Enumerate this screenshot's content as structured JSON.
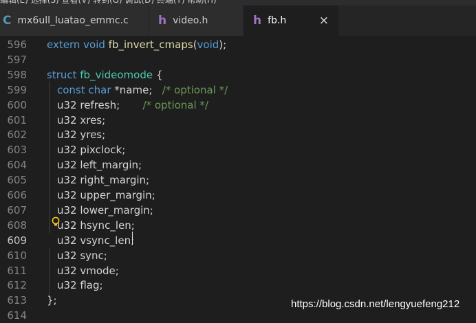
{
  "menubar": {
    "text": "编辑(E)  选择(S)  查看(V)  转到(G)  调试(D)  终端(T)  帮助(H)"
  },
  "tabs": [
    {
      "icon": "C",
      "icon_color": "#519aba",
      "label": "mx6ull_luatao_emmc.c",
      "active": false
    },
    {
      "icon": "h",
      "icon_color": "#a074c4",
      "label": "video.h",
      "active": false
    },
    {
      "icon": "h",
      "icon_color": "#a074c4",
      "label": "fb.h",
      "active": true,
      "close": "×"
    }
  ],
  "editor": {
    "current_line": "609",
    "lines": [
      {
        "n": "596",
        "tokens": [
          [
            "kw",
            "extern "
          ],
          [
            "kw",
            "void "
          ],
          [
            "fn",
            "fb_invert_cmaps"
          ],
          [
            "pu",
            "("
          ],
          [
            "kw",
            "void"
          ],
          [
            "pu",
            ");"
          ]
        ]
      },
      {
        "n": "597",
        "tokens": []
      },
      {
        "n": "598",
        "tokens": [
          [
            "kw",
            "struct "
          ],
          [
            "ty",
            "fb_videomode"
          ],
          [
            "pu",
            " {"
          ]
        ]
      },
      {
        "n": "599",
        "tokens": [
          [
            "kw",
            "const "
          ],
          [
            "kw",
            "char "
          ],
          [
            "pu",
            "*"
          ],
          [
            "id",
            "name"
          ],
          [
            "pu",
            ";   "
          ],
          [
            "cm",
            "/* optional */"
          ]
        ]
      },
      {
        "n": "600",
        "tokens": [
          [
            "id",
            "u32 refresh;"
          ],
          [
            "pu",
            "       "
          ],
          [
            "cm",
            "/* optional */"
          ]
        ]
      },
      {
        "n": "601",
        "tokens": [
          [
            "id",
            "u32 xres;"
          ]
        ]
      },
      {
        "n": "602",
        "tokens": [
          [
            "id",
            "u32 yres;"
          ]
        ]
      },
      {
        "n": "603",
        "tokens": [
          [
            "id",
            "u32 pixclock;"
          ]
        ]
      },
      {
        "n": "604",
        "tokens": [
          [
            "id",
            "u32 left_margin;"
          ]
        ]
      },
      {
        "n": "605",
        "tokens": [
          [
            "id",
            "u32 right_margin;"
          ]
        ]
      },
      {
        "n": "606",
        "tokens": [
          [
            "id",
            "u32 upper_margin;"
          ]
        ]
      },
      {
        "n": "607",
        "tokens": [
          [
            "id",
            "u32 lower_margin;"
          ]
        ]
      },
      {
        "n": "608",
        "tokens": [
          [
            "id",
            "u32 hsync_len;"
          ]
        ]
      },
      {
        "n": "609",
        "tokens": [
          [
            "id",
            "u32 vsync_len;"
          ]
        ]
      },
      {
        "n": "610",
        "tokens": [
          [
            "id",
            "u32 sync;"
          ]
        ]
      },
      {
        "n": "611",
        "tokens": [
          [
            "id",
            "u32 vmode;"
          ]
        ]
      },
      {
        "n": "612",
        "tokens": [
          [
            "id",
            "u32 flag;"
          ]
        ]
      },
      {
        "n": "613",
        "tokens": [
          [
            "pu",
            "};"
          ]
        ]
      },
      {
        "n": "614",
        "tokens": []
      }
    ]
  },
  "watermark": "https://blog.csdn.net/lengyuefeng212"
}
